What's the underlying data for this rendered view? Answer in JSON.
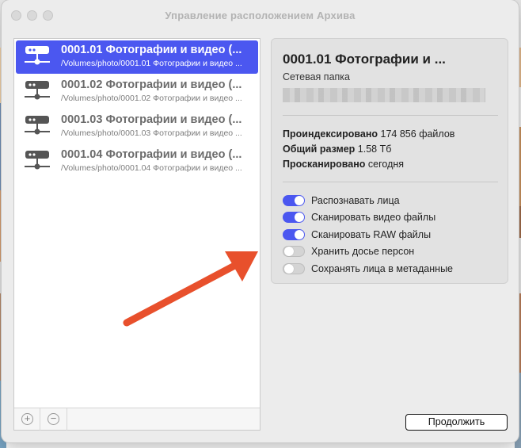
{
  "window": {
    "title": "Управление расположением Архива"
  },
  "list": {
    "items": [
      {
        "title": "0001.01 Фотографии и видео (...",
        "path": "/Volumes/photo/0001.01 Фотографии и видео ...",
        "selected": true
      },
      {
        "title": "0001.02 Фотографии и видео (...",
        "path": "/Volumes/photo/0001.02 Фотографии и видео ...",
        "selected": false
      },
      {
        "title": "0001.03 Фотографии и видео (...",
        "path": "/Volumes/photo/0001.03 Фотографии и видео ...",
        "selected": false
      },
      {
        "title": "0001.04 Фотографии и видео (...",
        "path": "/Volumes/photo/0001.04 Фотографии и видео ...",
        "selected": false
      }
    ],
    "add_symbol": "+",
    "remove_symbol": "−"
  },
  "details": {
    "title": "0001.01 Фотографии и ...",
    "type": "Сетевая папка",
    "indexed_label": "Проиндексировано",
    "indexed_value": "174 856 файлов",
    "size_label": "Общий размер",
    "size_value": "1.58 Тб",
    "scanned_label": "Просканировано",
    "scanned_value": "сегодня",
    "toggles": [
      {
        "label": "Распознавать лица",
        "on": true
      },
      {
        "label": "Сканировать видео файлы",
        "on": true
      },
      {
        "label": "Сканировать RAW файлы",
        "on": true
      },
      {
        "label": "Хранить досье персон",
        "on": false
      },
      {
        "label": "Сохранять лица в метаданные",
        "on": false
      }
    ]
  },
  "buttons": {
    "continue_label": "Продолжить"
  },
  "colors": {
    "accent": "#4b57f0",
    "annotation_arrow": "#e8502c"
  }
}
